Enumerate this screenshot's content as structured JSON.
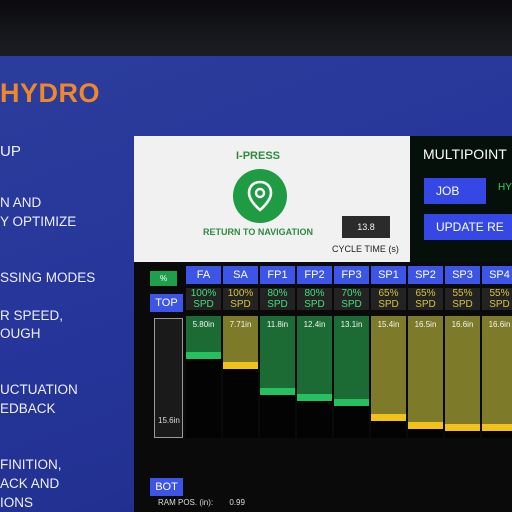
{
  "slide": {
    "title": "HYDRO",
    "bullets": [
      "UP",
      "N AND",
      "Y OPTIMIZE",
      "SSING MODES",
      "R SPEED,",
      "OUGH",
      "UCTUATION",
      "EDBACK",
      "FINITION,",
      "ACK AND",
      "IONS"
    ]
  },
  "hmi": {
    "ipress_label": "I-PRESS",
    "return_label": "RETURN TO NAVIGATION",
    "cycle_time_value": "13.8",
    "cycle_time_label": "CYCLE TIME (s)",
    "multipoint": {
      "title": "MULTIPOINT",
      "job_button": "JOB",
      "job_status": "HY",
      "update_button": "UPDATE RE"
    },
    "grid": {
      "pct_label": "%",
      "top_label": "TOP",
      "bot_label": "BOT",
      "ram_scale_value": "15.6in",
      "ram_pos_label": "RAM POS. (in):",
      "ram_pos_value": "0.99",
      "columns": [
        {
          "name": "FA",
          "speed": "100%\nSPD",
          "value": "5.80in",
          "level": 0.3
        },
        {
          "name": "SA",
          "speed": "100%\nSPD",
          "value": "7.71in",
          "level": 0.38
        },
        {
          "name": "FP1",
          "speed": "80%\nSPD",
          "value": "11.8in",
          "level": 0.6
        },
        {
          "name": "FP2",
          "speed": "80%\nSPD",
          "value": "12.4in",
          "level": 0.65
        },
        {
          "name": "FP3",
          "speed": "70%\nSPD",
          "value": "13.1in",
          "level": 0.69
        },
        {
          "name": "SP1",
          "speed": "65%\nSPD",
          "value": "15.4in",
          "level": 0.82
        },
        {
          "name": "SP2",
          "speed": "65%\nSPD",
          "value": "16.5in",
          "level": 0.88
        },
        {
          "name": "SP3",
          "speed": "55%\nSPD",
          "value": "16.6in",
          "level": 0.9
        },
        {
          "name": "SP4",
          "speed": "55%\nSPD",
          "value": "16.6in",
          "level": 0.9
        }
      ]
    }
  },
  "colors": {
    "slide_bg": "#26359a",
    "title_orange": "#f0872a",
    "hmi_blue": "#3c55e6",
    "green_fill": "#1d6b34",
    "green_marker": "#25c160",
    "yellow_fill": "#7d7a2a",
    "yellow_marker": "#f2c21a",
    "speed_green": "#3fe07a",
    "speed_yellow": "#d8c23a"
  }
}
